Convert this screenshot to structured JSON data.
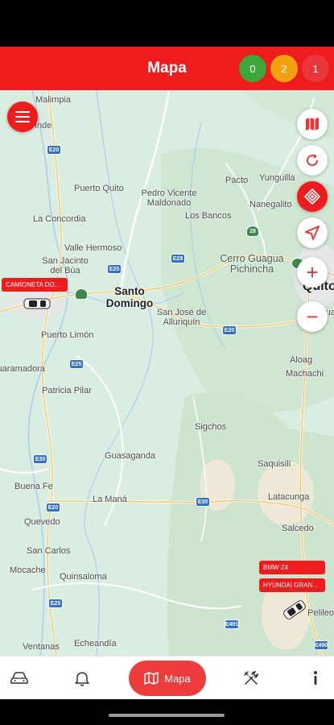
{
  "app_bar": {
    "title": "Mapa",
    "counters": [
      {
        "value": "0",
        "color": "#3aa83a"
      },
      {
        "value": "2",
        "color": "#f2a20c"
      },
      {
        "value": "1",
        "color": "#e8363a"
      }
    ]
  },
  "map": {
    "places": [
      "Malimpia",
      "Alluriquín",
      "Puerto Quito",
      "Pedro Vicente Maldonado",
      "Pacto",
      "Yunguilla",
      "Nanegalito",
      "La Concordia",
      "Los Bancos",
      "Valle Hermoso",
      "San Jacinto del Búa",
      "Cerro Guagua Pichincha",
      "Santo Domingo",
      "San José de Alluriquín",
      "Quito",
      "Amagua",
      "Puerto Limón",
      "Aloag",
      "Machachi",
      "Patricia Pilar",
      "Sigchos",
      "Guasaganda",
      "Saquisilí",
      "Buena Fe",
      "La Maná",
      "Latacunga",
      "Quevedo",
      "Salcedo",
      "San Carlos",
      "Mocache",
      "Quinsaloma",
      "Ventanas",
      "Echeandía",
      "Pelileo",
      "Inde",
      "Guaramadora"
    ],
    "roads": [
      "E20",
      "E25",
      "E28",
      "E20",
      "E25",
      "E30",
      "E20",
      "E25",
      "E491",
      "E490",
      "28",
      "E25"
    ]
  },
  "vehicles": [
    {
      "label": "CAMIONETA DO..."
    },
    {
      "label": "BMW Z4"
    },
    {
      "label": "HYUNDAI GRAN..."
    }
  ],
  "controls": {
    "layers_icon": "map-icon",
    "refresh_icon": "refresh-icon",
    "locate_icon": "gps-target-icon",
    "navigate_icon": "navigation-arrow-icon",
    "zoom_in": "+",
    "zoom_out": "−"
  },
  "bottom_nav": {
    "items": [
      {
        "icon": "car-icon"
      },
      {
        "icon": "bell-icon"
      },
      {
        "icon": "map-icon",
        "label": "Mapa"
      },
      {
        "icon": "tools-icon"
      },
      {
        "icon": "info-icon"
      }
    ]
  }
}
